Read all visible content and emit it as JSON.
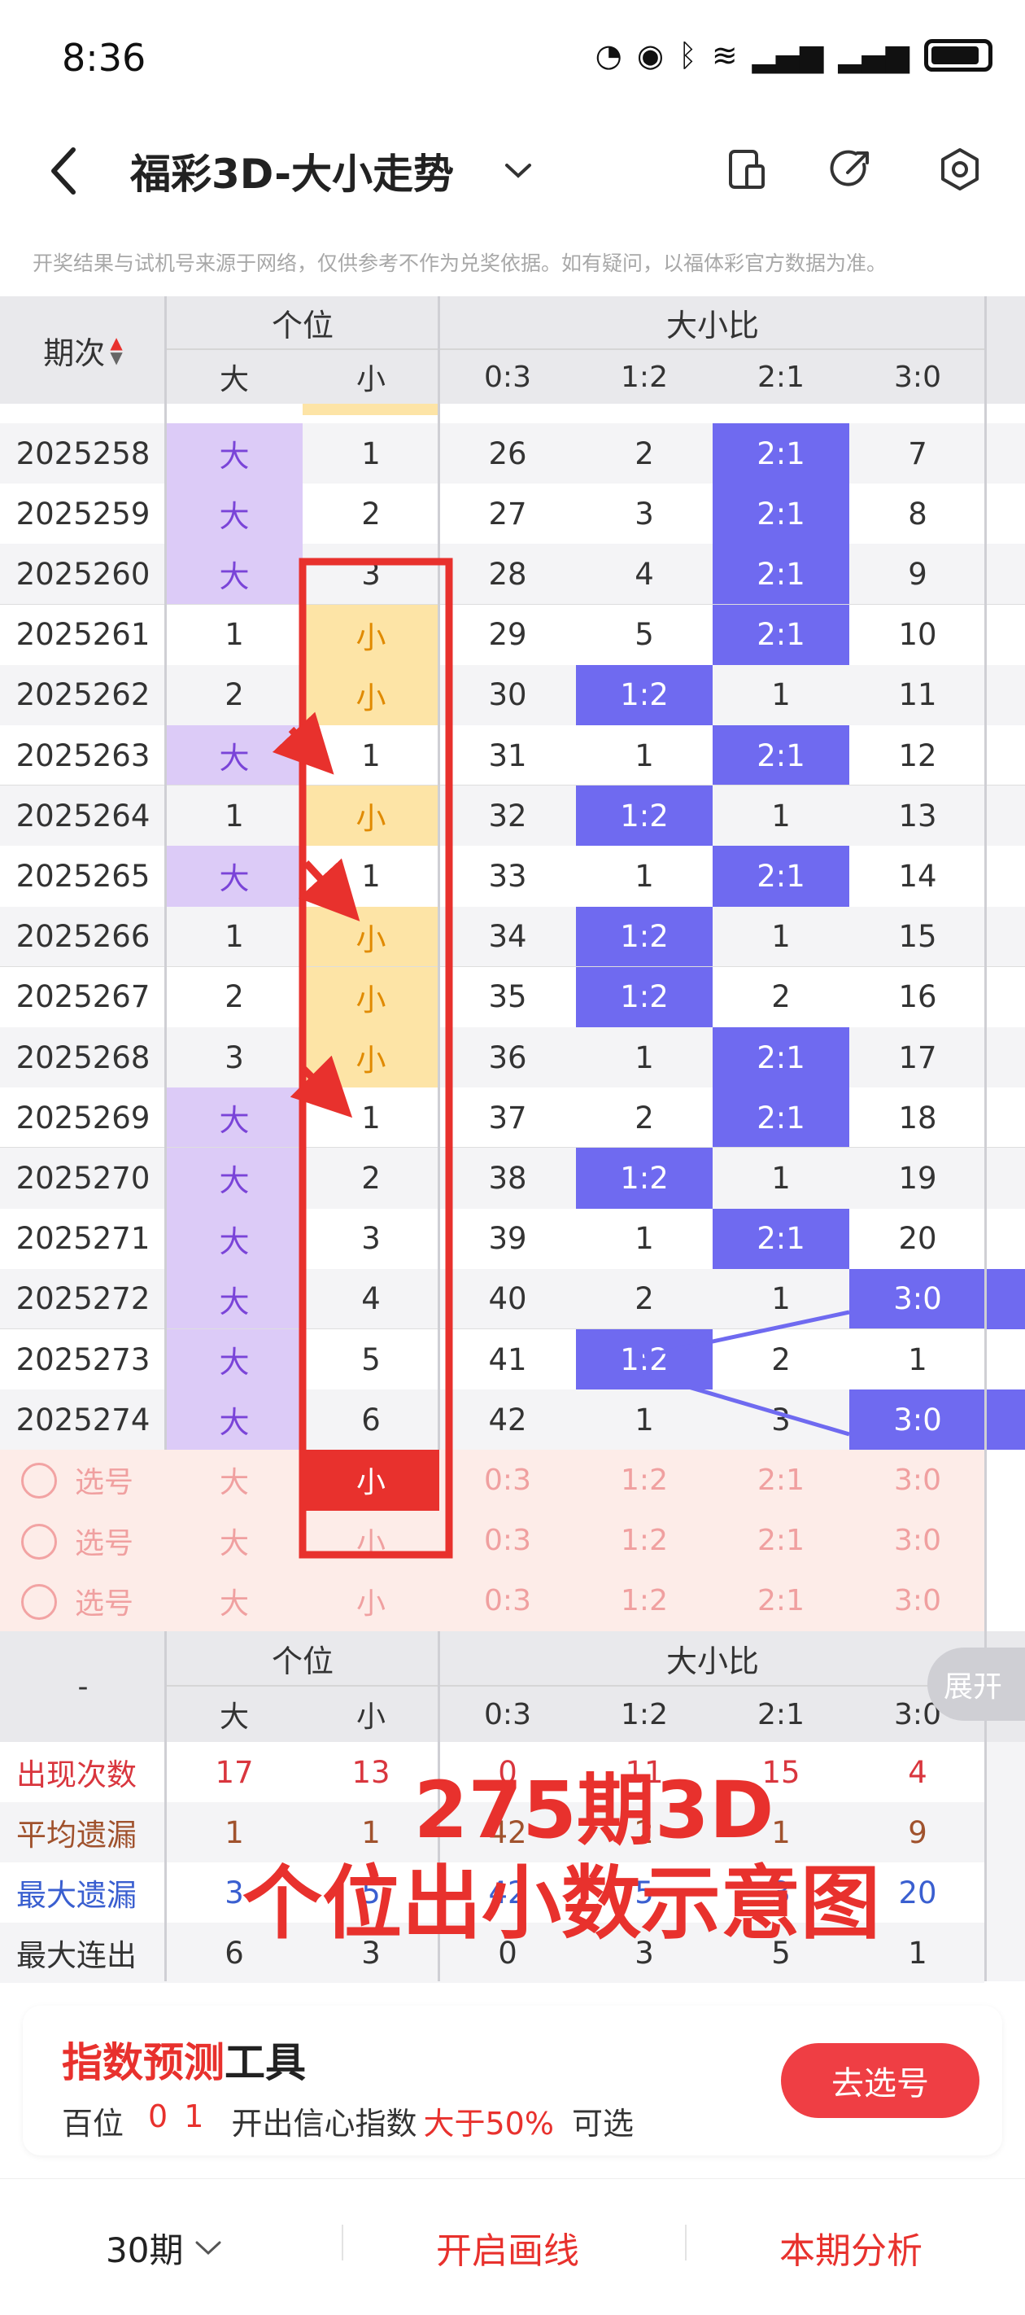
{
  "status": {
    "time": "8:36"
  },
  "appbar": {
    "title": "福彩3D-大小走势",
    "back_icon": "chevron-left-icon"
  },
  "disclaimer": "开奖结果与试机号来源于网络，仅供参考不作为兑奖依据。如有疑问，以福体彩官方数据为准。",
  "table_header": {
    "period": "期次",
    "group_ones": "个位",
    "group_ratio": "大小比",
    "cols": [
      "大",
      "小",
      "0:3",
      "1:2",
      "2:1",
      "3:0"
    ]
  },
  "rows": [
    {
      "period": "2025258",
      "da": "大",
      "xiao": "1",
      "r03": "26",
      "r12": "2",
      "r21": "2:1",
      "r30": "7"
    },
    {
      "period": "2025259",
      "da": "大",
      "xiao": "2",
      "r03": "27",
      "r12": "3",
      "r21": "2:1",
      "r30": "8"
    },
    {
      "period": "2025260",
      "da": "大",
      "xiao": "3",
      "r03": "28",
      "r12": "4",
      "r21": "2:1",
      "r30": "9"
    },
    {
      "period": "2025261",
      "da": "1",
      "xiao": "小",
      "r03": "29",
      "r12": "5",
      "r21": "2:1",
      "r30": "10"
    },
    {
      "period": "2025262",
      "da": "2",
      "xiao": "小",
      "r03": "30",
      "r12": "1:2",
      "r21": "1",
      "r30": "11"
    },
    {
      "period": "2025263",
      "da": "大",
      "xiao": "1",
      "r03": "31",
      "r12": "1",
      "r21": "2:1",
      "r30": "12"
    },
    {
      "period": "2025264",
      "da": "1",
      "xiao": "小",
      "r03": "32",
      "r12": "1:2",
      "r21": "1",
      "r30": "13"
    },
    {
      "period": "2025265",
      "da": "大",
      "xiao": "1",
      "r03": "33",
      "r12": "1",
      "r21": "2:1",
      "r30": "14"
    },
    {
      "period": "2025266",
      "da": "1",
      "xiao": "小",
      "r03": "34",
      "r12": "1:2",
      "r21": "1",
      "r30": "15"
    },
    {
      "period": "2025267",
      "da": "2",
      "xiao": "小",
      "r03": "35",
      "r12": "1:2",
      "r21": "2",
      "r30": "16"
    },
    {
      "period": "2025268",
      "da": "3",
      "xiao": "小",
      "r03": "36",
      "r12": "1",
      "r21": "2:1",
      "r30": "17"
    },
    {
      "period": "2025269",
      "da": "大",
      "xiao": "1",
      "r03": "37",
      "r12": "2",
      "r21": "2:1",
      "r30": "18"
    },
    {
      "period": "2025270",
      "da": "大",
      "xiao": "2",
      "r03": "38",
      "r12": "1:2",
      "r21": "1",
      "r30": "19"
    },
    {
      "period": "2025271",
      "da": "大",
      "xiao": "3",
      "r03": "39",
      "r12": "1",
      "r21": "2:1",
      "r30": "20"
    },
    {
      "period": "2025272",
      "da": "大",
      "xiao": "4",
      "r03": "40",
      "r12": "2",
      "r21": "1",
      "r30": "3:0"
    },
    {
      "period": "2025273",
      "da": "大",
      "xiao": "5",
      "r03": "41",
      "r12": "1:2",
      "r21": "2",
      "r30": "1"
    },
    {
      "period": "2025274",
      "da": "大",
      "xiao": "6",
      "r03": "42",
      "r12": "1",
      "r21": "3",
      "r30": "3:0"
    }
  ],
  "pick_rows": [
    {
      "label": "选号",
      "cells": [
        "大",
        "小",
        "0:3",
        "1:2",
        "2:1",
        "3:0"
      ]
    },
    {
      "label": "选号",
      "cells": [
        "大",
        "小",
        "0:3",
        "1:2",
        "2:1",
        "3:0"
      ]
    },
    {
      "label": "选号",
      "cells": [
        "大",
        "小",
        "0:3",
        "1:2",
        "2:1",
        "3:0"
      ]
    }
  ],
  "summary": {
    "dash": "-",
    "group_ones": "个位",
    "group_ratio": "大小比",
    "cols": [
      "大",
      "小",
      "0:3",
      "1:2",
      "2:1",
      "3:0"
    ],
    "expand": "展开",
    "stats": [
      {
        "label": "出现次数",
        "color": "#d9363e",
        "values": [
          "17",
          "13",
          "0",
          "11",
          "15",
          "4"
        ]
      },
      {
        "label": "平均遗漏",
        "color": "#a0522d",
        "values": [
          "1",
          "1",
          "42",
          "2",
          "1",
          "9"
        ]
      },
      {
        "label": "最大遗漏",
        "color": "#3a5fd0",
        "values": [
          "3",
          "5",
          "42",
          "5",
          "3",
          "20"
        ]
      },
      {
        "label": "最大连出",
        "color": "#333333",
        "values": [
          "6",
          "3",
          "0",
          "3",
          "5",
          "1"
        ]
      }
    ]
  },
  "overlay": {
    "line1": "275期3D",
    "line2": "个位出小数示意图"
  },
  "card": {
    "title_red": "指数预测",
    "title_black": "工具",
    "row_pos": "百位",
    "row_nums": "0 1",
    "row_text": "开出信心指数",
    "row_pct": "大于50%",
    "row_tail": "可选",
    "button": "去选号"
  },
  "bottom": {
    "periods": "30期",
    "draw": "开启画线",
    "analysis": "本期分析"
  },
  "colors": {
    "purple": "#dccbf7",
    "orange": "#fde4a6",
    "blue": "#6f6af0",
    "red": "#e8312d"
  }
}
